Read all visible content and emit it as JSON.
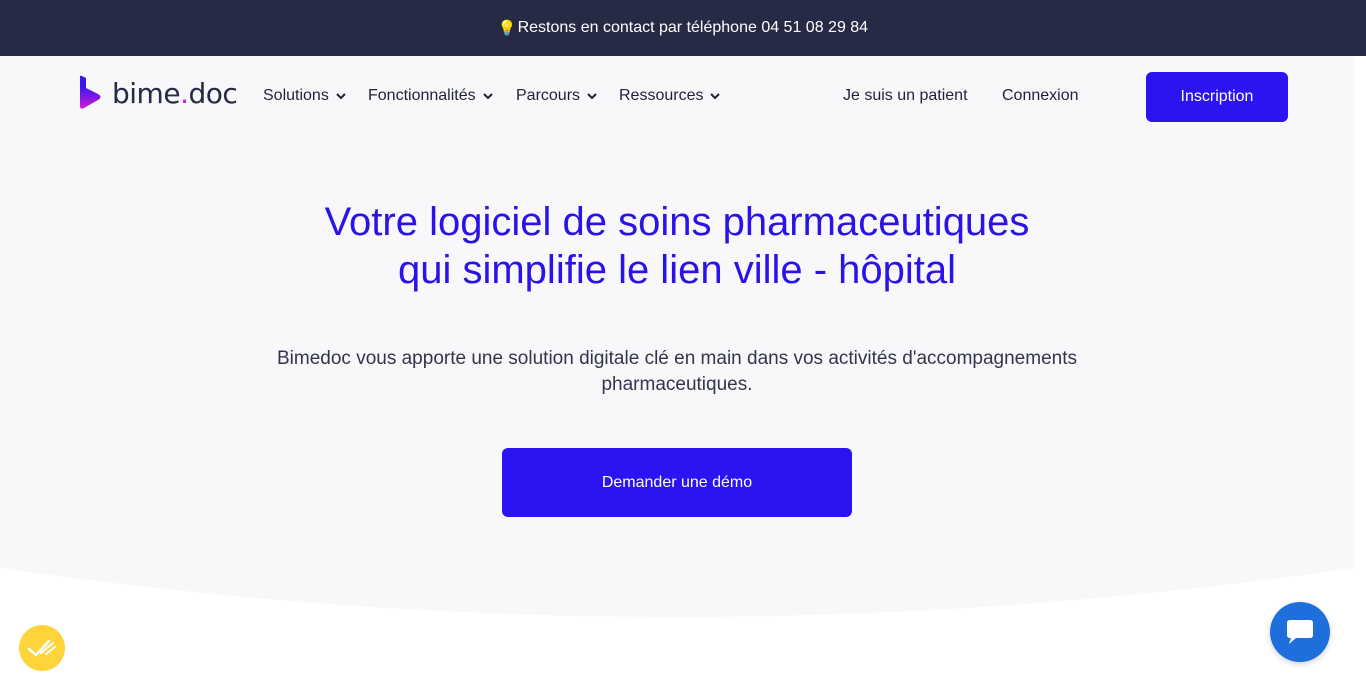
{
  "announcement": {
    "icon": "lightbulb-icon",
    "emoji": "💡",
    "text": "Restons en contact par téléphone 04 51 08 29 84"
  },
  "brand": {
    "name_prefix": "bime",
    "name_dot": ".",
    "name_suffix": "doc",
    "accent": "#c81fd8"
  },
  "nav": {
    "menu": [
      {
        "label": "Solutions"
      },
      {
        "label": "Fonctionnalités"
      },
      {
        "label": "Parcours"
      },
      {
        "label": "Ressources"
      }
    ],
    "patient_link": "Je suis un patient",
    "login_link": "Connexion",
    "signup_button": "Inscription"
  },
  "hero": {
    "title_line1": "Votre logiciel de soins pharmaceutiques",
    "title_line2": "qui simplifie le lien ville - hôpital",
    "subtitle": "Bimedoc vous apporte une solution digitale clé en main dans vos activités d'accompagnements pharmaceutiques.",
    "cta": "Demander une démo"
  },
  "colors": {
    "primary": "#2b13f2",
    "topbar": "#272a45",
    "chat": "#1e6fdc",
    "badge": "#ffd43b"
  },
  "widgets": {
    "left_badge_icon": "checkmark-badge-icon",
    "chat_icon": "chat-bubble-icon"
  }
}
